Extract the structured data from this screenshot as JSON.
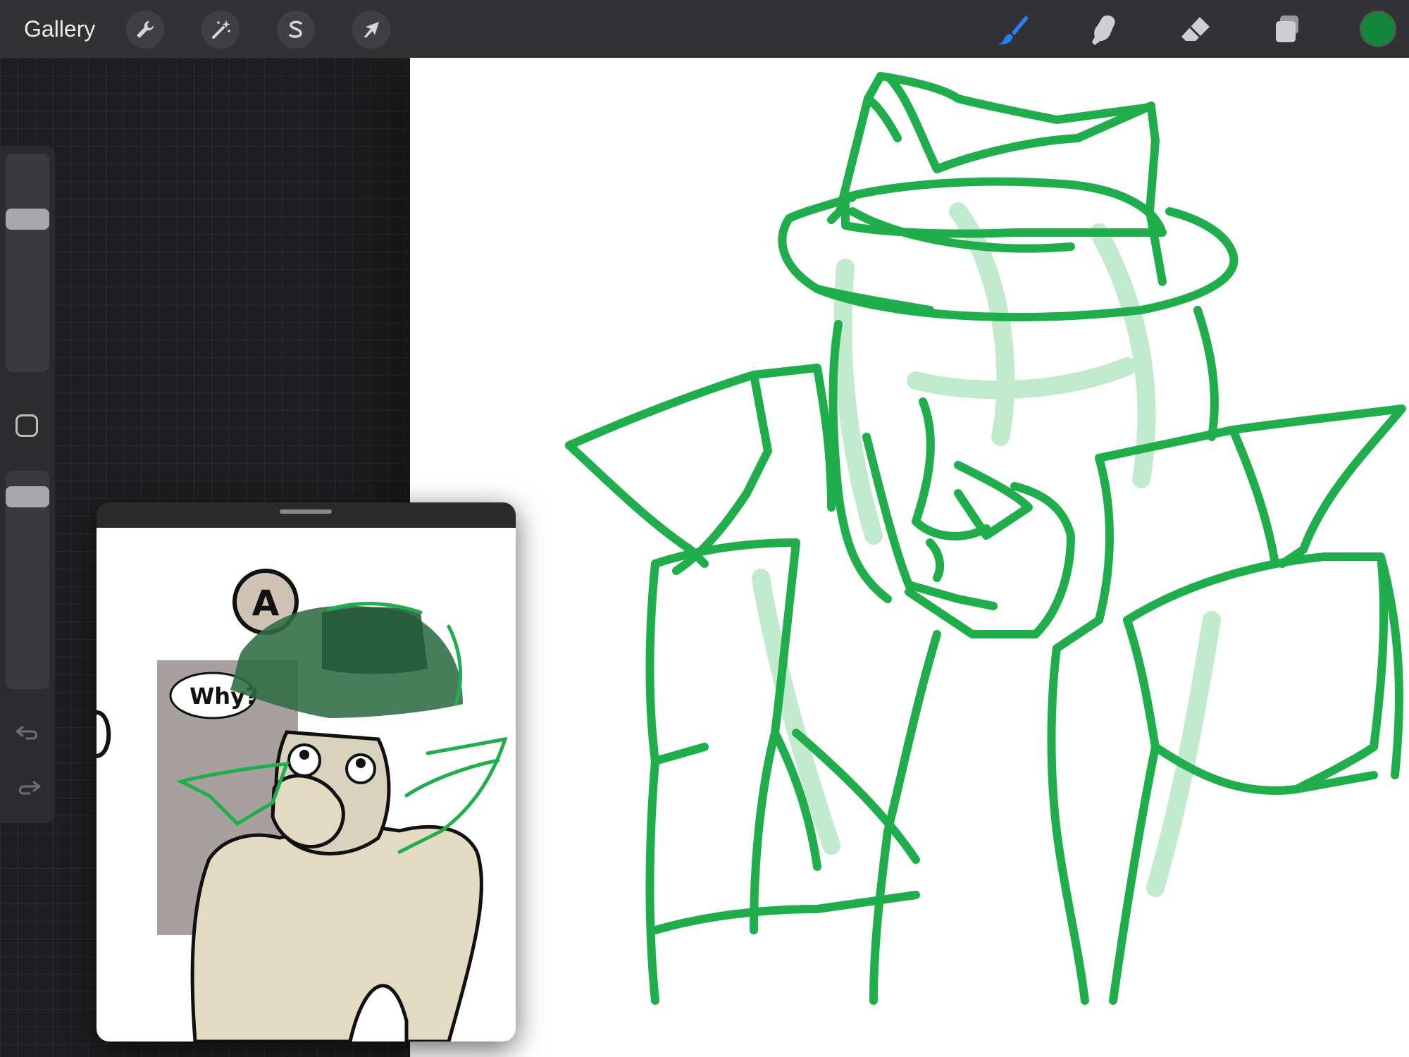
{
  "toolbar": {
    "gallery_label": "Gallery",
    "left_tools": [
      {
        "name": "actions",
        "icon": "wrench-icon"
      },
      {
        "name": "adjustments",
        "icon": "magic-wand-icon"
      },
      {
        "name": "selection",
        "icon": "selection-s-icon"
      },
      {
        "name": "transform",
        "icon": "arrow-cursor-icon"
      }
    ],
    "right_tools": [
      {
        "name": "brush",
        "icon": "brush-icon",
        "active": true
      },
      {
        "name": "smudge",
        "icon": "smudge-finger-icon"
      },
      {
        "name": "eraser",
        "icon": "eraser-icon"
      },
      {
        "name": "layers",
        "icon": "layers-icon"
      }
    ],
    "current_color": "#12863a"
  },
  "sidebar": {
    "brush_size_level": 0.72,
    "opacity_level": 0.92
  },
  "reference": {
    "bubble_letter": "A",
    "speech_text": "Why?"
  },
  "colors": {
    "stroke_green": "#1fae4b",
    "active_blue": "#2b7df5",
    "icon_gray": "#cfcfd1"
  }
}
